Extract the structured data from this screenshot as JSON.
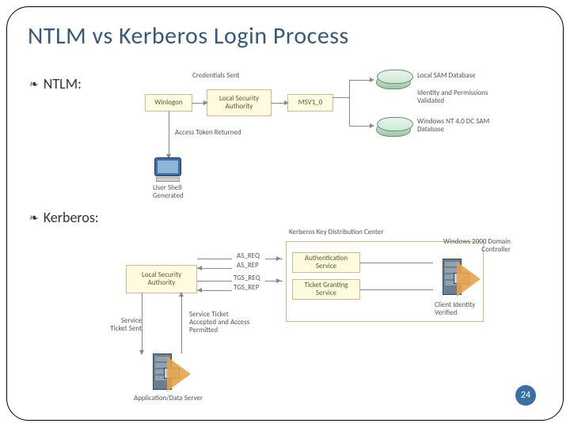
{
  "title": "NTLM vs Kerberos Login Process",
  "page_number": "24",
  "bullets": {
    "ntlm": "NTLM:",
    "kerberos": "Kerberos:"
  },
  "ntlm": {
    "credentials_sent": "Credentials Sent",
    "winlogon": "Winlogon",
    "lsa": "Local Security Authority",
    "msv": "MSV1_0",
    "local_sam": "Local SAM Database",
    "identity": "Identity and Permissions Validated",
    "nt4dc": "Windows NT 4.0 DC SAM Database",
    "token": "Access Token Returned",
    "shell": "User Shell Generated"
  },
  "kerberos": {
    "kdc_title": "Kerberos Key Distribution Center",
    "dc": "Windows 2000 Domain Controller",
    "lsa": "Local Security Authority",
    "as_req": "AS_REQ",
    "as_rep": "AS_REP",
    "tgs_req": "TGS_REQ",
    "tgs_rep": "TGS_REP",
    "auth_svc": "Authentication Service",
    "tgs_svc": "Ticket Granting Service",
    "identity": "Client Identity Verified",
    "service_ticket": "Service Ticket Sent",
    "accepted": "Service Ticket Accepted and Access Permitted",
    "appserver": "Application/Data Server"
  }
}
